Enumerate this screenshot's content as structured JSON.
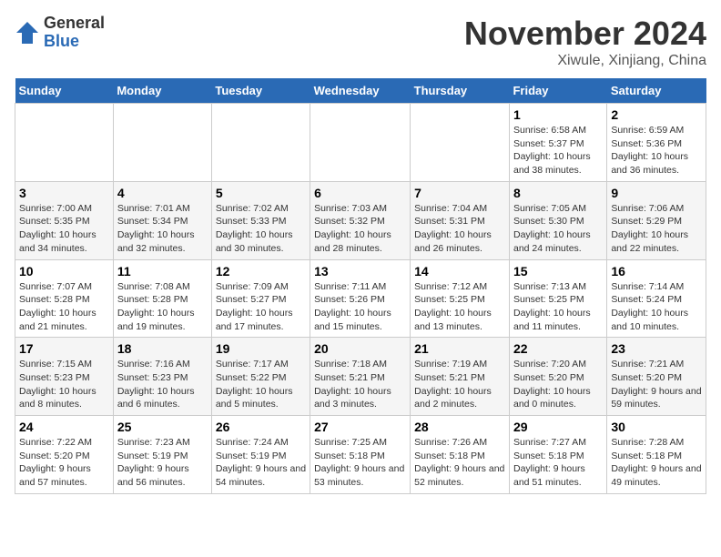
{
  "logo": {
    "general": "General",
    "blue": "Blue"
  },
  "header": {
    "month": "November 2024",
    "location": "Xiwule, Xinjiang, China"
  },
  "weekdays": [
    "Sunday",
    "Monday",
    "Tuesday",
    "Wednesday",
    "Thursday",
    "Friday",
    "Saturday"
  ],
  "weeks": [
    [
      {
        "day": "",
        "info": ""
      },
      {
        "day": "",
        "info": ""
      },
      {
        "day": "",
        "info": ""
      },
      {
        "day": "",
        "info": ""
      },
      {
        "day": "",
        "info": ""
      },
      {
        "day": "1",
        "info": "Sunrise: 6:58 AM\nSunset: 5:37 PM\nDaylight: 10 hours and 38 minutes."
      },
      {
        "day": "2",
        "info": "Sunrise: 6:59 AM\nSunset: 5:36 PM\nDaylight: 10 hours and 36 minutes."
      }
    ],
    [
      {
        "day": "3",
        "info": "Sunrise: 7:00 AM\nSunset: 5:35 PM\nDaylight: 10 hours and 34 minutes."
      },
      {
        "day": "4",
        "info": "Sunrise: 7:01 AM\nSunset: 5:34 PM\nDaylight: 10 hours and 32 minutes."
      },
      {
        "day": "5",
        "info": "Sunrise: 7:02 AM\nSunset: 5:33 PM\nDaylight: 10 hours and 30 minutes."
      },
      {
        "day": "6",
        "info": "Sunrise: 7:03 AM\nSunset: 5:32 PM\nDaylight: 10 hours and 28 minutes."
      },
      {
        "day": "7",
        "info": "Sunrise: 7:04 AM\nSunset: 5:31 PM\nDaylight: 10 hours and 26 minutes."
      },
      {
        "day": "8",
        "info": "Sunrise: 7:05 AM\nSunset: 5:30 PM\nDaylight: 10 hours and 24 minutes."
      },
      {
        "day": "9",
        "info": "Sunrise: 7:06 AM\nSunset: 5:29 PM\nDaylight: 10 hours and 22 minutes."
      }
    ],
    [
      {
        "day": "10",
        "info": "Sunrise: 7:07 AM\nSunset: 5:28 PM\nDaylight: 10 hours and 21 minutes."
      },
      {
        "day": "11",
        "info": "Sunrise: 7:08 AM\nSunset: 5:28 PM\nDaylight: 10 hours and 19 minutes."
      },
      {
        "day": "12",
        "info": "Sunrise: 7:09 AM\nSunset: 5:27 PM\nDaylight: 10 hours and 17 minutes."
      },
      {
        "day": "13",
        "info": "Sunrise: 7:11 AM\nSunset: 5:26 PM\nDaylight: 10 hours and 15 minutes."
      },
      {
        "day": "14",
        "info": "Sunrise: 7:12 AM\nSunset: 5:25 PM\nDaylight: 10 hours and 13 minutes."
      },
      {
        "day": "15",
        "info": "Sunrise: 7:13 AM\nSunset: 5:25 PM\nDaylight: 10 hours and 11 minutes."
      },
      {
        "day": "16",
        "info": "Sunrise: 7:14 AM\nSunset: 5:24 PM\nDaylight: 10 hours and 10 minutes."
      }
    ],
    [
      {
        "day": "17",
        "info": "Sunrise: 7:15 AM\nSunset: 5:23 PM\nDaylight: 10 hours and 8 minutes."
      },
      {
        "day": "18",
        "info": "Sunrise: 7:16 AM\nSunset: 5:23 PM\nDaylight: 10 hours and 6 minutes."
      },
      {
        "day": "19",
        "info": "Sunrise: 7:17 AM\nSunset: 5:22 PM\nDaylight: 10 hours and 5 minutes."
      },
      {
        "day": "20",
        "info": "Sunrise: 7:18 AM\nSunset: 5:21 PM\nDaylight: 10 hours and 3 minutes."
      },
      {
        "day": "21",
        "info": "Sunrise: 7:19 AM\nSunset: 5:21 PM\nDaylight: 10 hours and 2 minutes."
      },
      {
        "day": "22",
        "info": "Sunrise: 7:20 AM\nSunset: 5:20 PM\nDaylight: 10 hours and 0 minutes."
      },
      {
        "day": "23",
        "info": "Sunrise: 7:21 AM\nSunset: 5:20 PM\nDaylight: 9 hours and 59 minutes."
      }
    ],
    [
      {
        "day": "24",
        "info": "Sunrise: 7:22 AM\nSunset: 5:20 PM\nDaylight: 9 hours and 57 minutes."
      },
      {
        "day": "25",
        "info": "Sunrise: 7:23 AM\nSunset: 5:19 PM\nDaylight: 9 hours and 56 minutes."
      },
      {
        "day": "26",
        "info": "Sunrise: 7:24 AM\nSunset: 5:19 PM\nDaylight: 9 hours and 54 minutes."
      },
      {
        "day": "27",
        "info": "Sunrise: 7:25 AM\nSunset: 5:18 PM\nDaylight: 9 hours and 53 minutes."
      },
      {
        "day": "28",
        "info": "Sunrise: 7:26 AM\nSunset: 5:18 PM\nDaylight: 9 hours and 52 minutes."
      },
      {
        "day": "29",
        "info": "Sunrise: 7:27 AM\nSunset: 5:18 PM\nDaylight: 9 hours and 51 minutes."
      },
      {
        "day": "30",
        "info": "Sunrise: 7:28 AM\nSunset: 5:18 PM\nDaylight: 9 hours and 49 minutes."
      }
    ]
  ]
}
